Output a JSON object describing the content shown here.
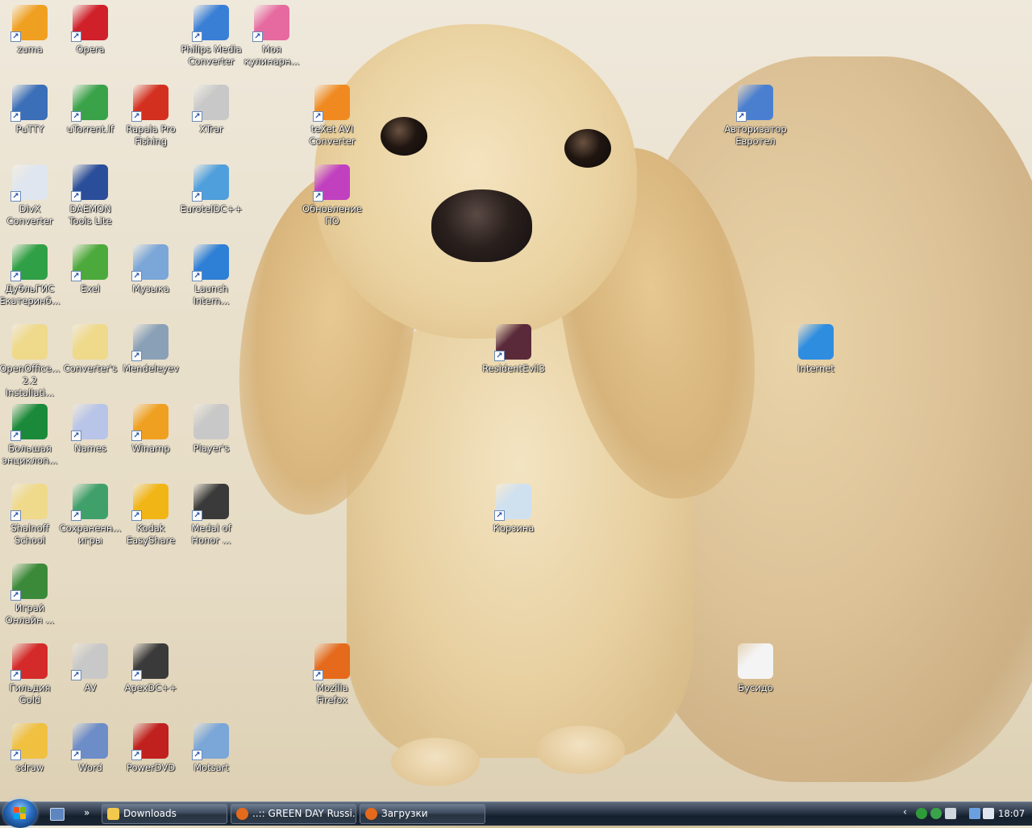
{
  "desktop": {
    "icons": [
      {
        "label": "zuma",
        "color": "#f0a020"
      },
      {
        "label": "Opera",
        "color": "#d0202a"
      },
      {
        "label": "Philips Media\nConverter",
        "color": "#3a7fd6"
      },
      {
        "label": "Моя\nкулинарн...",
        "color": "#e66aa0"
      },
      {
        "label": "PuTTY",
        "color": "#3b6fb8"
      },
      {
        "label": "uTorrent.lf",
        "color": "#3aa34a"
      },
      {
        "label": "Rapala Pro\nFishing",
        "color": "#d43020"
      },
      {
        "label": "XTrar",
        "color": "#c8c8c8"
      },
      {
        "label": "teXet AVI\nConverter",
        "color": "#f08a20"
      },
      {
        "label": "Авторизатор\nЕвротел",
        "color": "#4a7fd0"
      },
      {
        "label": "DivX\nConverter",
        "color": "#dfe6ef"
      },
      {
        "label": "DAEMON\nTools Lite",
        "color": "#2a4e9a"
      },
      {
        "label": "EurotelDC++",
        "color": "#4f9fdc"
      },
      {
        "label": "Обновление\nПО",
        "color": "#c040c0"
      },
      {
        "label": "ДубльГИС\nЕкатеринб...",
        "color": "#2fa046"
      },
      {
        "label": "Exel",
        "color": "#4caa3c"
      },
      {
        "label": "Музыка",
        "color": "#7aa6d8"
      },
      {
        "label": "Launch\nIntern...",
        "color": "#2e7fd6"
      },
      {
        "label": "OpenOffice...\n2.2 Installati...",
        "color": "#efd98a"
      },
      {
        "label": "Converter's",
        "color": "#efd98a"
      },
      {
        "label": "Mendeleyev",
        "color": "#8aa0b6"
      },
      {
        "label": "ResidentEvil3",
        "color": "#5a2a3a"
      },
      {
        "label": "Internet",
        "color": "#2f8de0"
      },
      {
        "label": "Большая\nэнциклоп...",
        "color": "#1a8a3a"
      },
      {
        "label": "Names",
        "color": "#b8c4e8"
      },
      {
        "label": "Winamp",
        "color": "#f0a020"
      },
      {
        "label": "Player's",
        "color": "#c8c8c8"
      },
      {
        "label": "Shalnoff\nSchool",
        "color": "#efd98a"
      },
      {
        "label": "Сохраненн...\nигры",
        "color": "#3fa06a"
      },
      {
        "label": "Kodak\nEasyShare",
        "color": "#f2b516"
      },
      {
        "label": "Medal of\nHonor ...",
        "color": "#3a3a3a"
      },
      {
        "label": "Корзина",
        "color": "#cfe0ef"
      },
      {
        "label": "Играй\nОнлайн ...",
        "color": "#3b8a3a"
      },
      {
        "label": "Гильдия\nGold",
        "color": "#d42a2a"
      },
      {
        "label": "AV",
        "color": "#c8c8c8"
      },
      {
        "label": "ApexDC++",
        "color": "#3a3a3a"
      },
      {
        "label": "Mozilla\nFirefox",
        "color": "#e56a1c"
      },
      {
        "label": "Бусидо",
        "color": "#f4f4f4"
      },
      {
        "label": "sdraw",
        "color": "#f0c040"
      },
      {
        "label": "Word",
        "color": "#6d8dc8"
      },
      {
        "label": "PowerDVD",
        "color": "#c0201e"
      },
      {
        "label": "Motsart",
        "color": "#7aa6d8"
      }
    ]
  },
  "taskbar": {
    "start_icon": "windows-logo-icon",
    "quick_launch_icon": "show-desktop-icon",
    "more_label": "»",
    "buttons": [
      {
        "label": "Downloads",
        "icon_color": "#f2c94c"
      },
      {
        "label": "..:: GREEN DAY Russi...",
        "icon_color": "#e56a1c"
      },
      {
        "label": "Загрузки",
        "icon_color": "#e56a1c"
      }
    ],
    "tray": {
      "chevron": "‹",
      "clock": "18:07"
    }
  }
}
